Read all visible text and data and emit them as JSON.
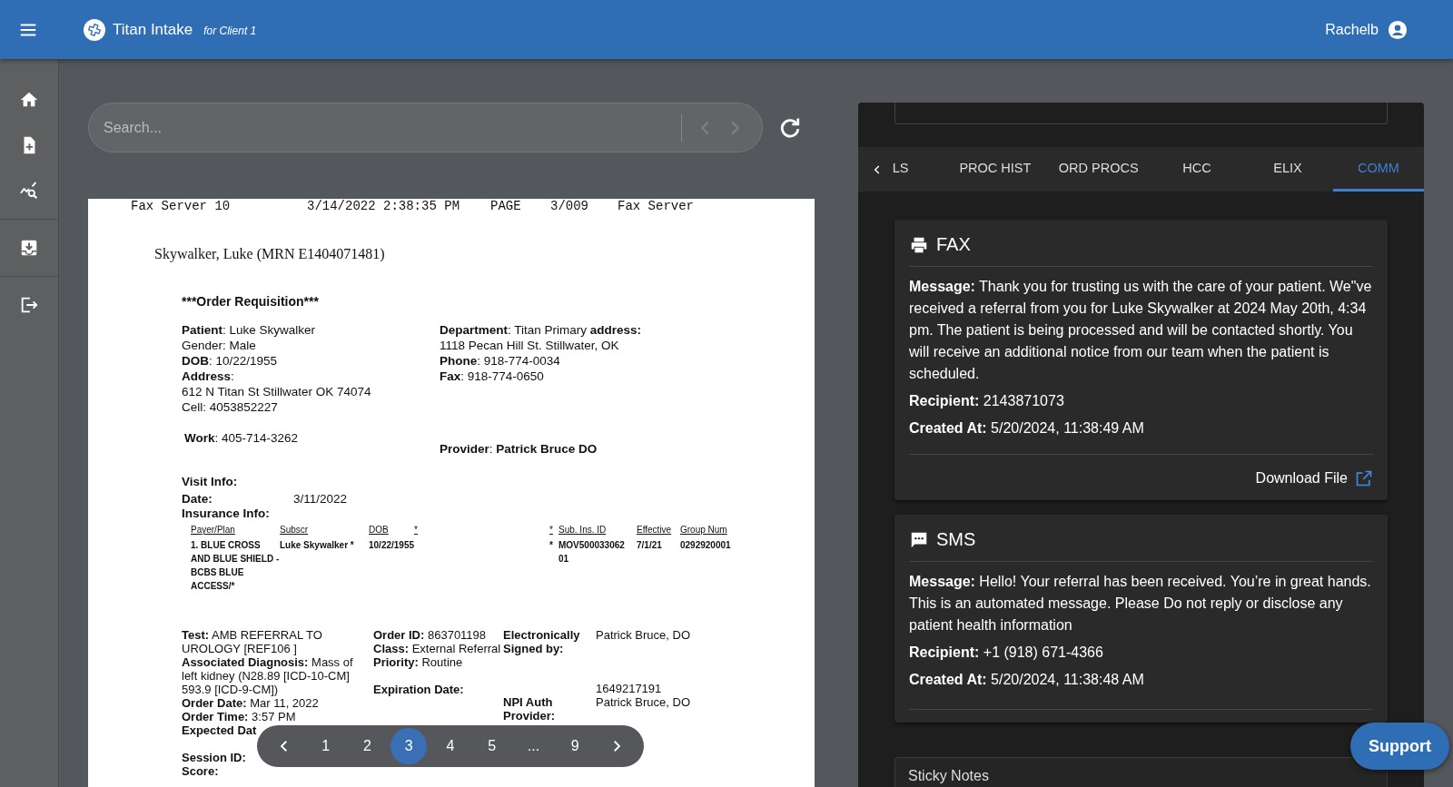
{
  "app_bar": {
    "app_name": "Titan Intake",
    "client": "for Client 1",
    "user": "Rachelb"
  },
  "sidebar": {
    "items": [
      {
        "kind": "home"
      },
      {
        "kind": "new-document"
      },
      {
        "kind": "analytics"
      },
      {
        "kind": "inbox"
      },
      {
        "kind": "logout"
      }
    ]
  },
  "search": {
    "placeholder": "Search..."
  },
  "document": {
    "fax_header": [
      "Fax Server 10",
      "3/14/2022 2:38:35 PM",
      "PAGE",
      "3/009",
      "Fax Server"
    ],
    "patient_heading": "Skywalker, Luke (MRN E1404071481)",
    "title": "***Order Requisition***",
    "patient_lines": [
      "**Patient**:  Luke Skywalker",
      "Gender: Male",
      "**DOB**: 10/22/1955",
      "**Address**:",
      "612 N Titan St Stillwater OK 74074",
      "Cell: 4053852227"
    ],
    "department_lines": [
      "**Department**: Titan Primary **address:**",
      "1118 Pecan Hill St. Stillwater, OK",
      "**Phone**: 918-774-0034",
      "**Fax**: 918-774-0650"
    ],
    "work": "**Work**: 405-714-3262",
    "provider": "**Provider**: **Patrick  Bruce  DO**",
    "visit_heading": "Visit Info:",
    "visit_date": {
      "label": "Date:",
      "value": "3/11/2022"
    },
    "insurance_heading": "Insurance Info:",
    "insurance_left": [
      {
        "header": "Payer/Plan",
        "value": "1. BLUE CROSS AND BLUE SHIELD - BCBS BLUE ACCESS/*"
      },
      {
        "header": "Subscr",
        "value": "Luke  Skywalker *"
      },
      {
        "header": "DOB",
        "value": "10/22/1955"
      },
      {
        "header": "*"
      }
    ],
    "insurance_right": [
      {
        "header": "*",
        "value": "*"
      },
      {
        "header": "Sub. Ins. ID",
        "value": "MOV500033062 01"
      },
      {
        "header": "Effective",
        "value": "7/1/21"
      },
      {
        "header": "Group Num",
        "value": "0292920001"
      }
    ],
    "order_columns": [
      [
        "**Test:**  AMB REFERRAL TO UROLOGY [REF106 ]",
        "**Associated Diagnosis:** Mass of left kidney (N28.89 [ICD-10-CM] 593.9 [ICD-9-CM])",
        "**Order Date:** Mar 11, 2022",
        "**Order Time:** 3:57 PM",
        "**Expected Dat**",
        "**Session ID:**",
        "**Score:**"
      ],
      [
        "**Order ID:** 863701198",
        "**Class:** External Referral",
        "**Priority:** Routine",
        "**Expiration Date:**"
      ],
      [
        "**Electronically Signed by:**",
        "**NPI Auth Provider:**"
      ],
      [
        "Patrick  Bruce, DO",
        "1649217191",
        "Patrick  Bruce, DO"
      ]
    ]
  },
  "pagination": {
    "pages": [
      {
        "label": "1",
        "selected": false
      },
      {
        "label": "2",
        "selected": false
      },
      {
        "label": "3",
        "selected": true
      },
      {
        "label": "4",
        "selected": false
      },
      {
        "label": "5",
        "selected": false
      },
      {
        "label": "...",
        "selected": false
      },
      {
        "label": "9",
        "selected": false
      }
    ]
  },
  "tabs": [
    {
      "label": "LS",
      "selected": false
    },
    {
      "label": "PROC HIST",
      "selected": false
    },
    {
      "label": "ORD PROCS",
      "selected": false
    },
    {
      "label": "HCC",
      "selected": false
    },
    {
      "label": "ELIX",
      "selected": false
    },
    {
      "label": "COMM",
      "selected": true
    }
  ],
  "comm_cards": [
    {
      "kind": "fax",
      "title": "FAX",
      "message": "**Message:** Thank you for trusting us with the care of your patient. We\"ve received a referral from you for Luke Skywalker at 2024 May 20th, 4:34 pm. The patient is being processed and will be contacted shortly. You will receive an additional notice from our team when the patient is scheduled.",
      "recipient": "**Recipient:** 2143871073",
      "created": "**Created At:** 5/20/2024, 11:38:49 AM",
      "link": "Download File"
    },
    {
      "kind": "sms",
      "title": "SMS",
      "message": "**Message:** Hello! Your referral has been received. You’re in great hands. This is an automated message. Please Do not reply or disclose any patient health information",
      "recipient": "**Recipient:** +1 (918) 671-4366",
      "created": "**Created At:** 5/20/2024, 11:38:48 AM"
    }
  ],
  "sticky_notes": {
    "title": "Sticky Notes"
  },
  "support_button": "Support"
}
